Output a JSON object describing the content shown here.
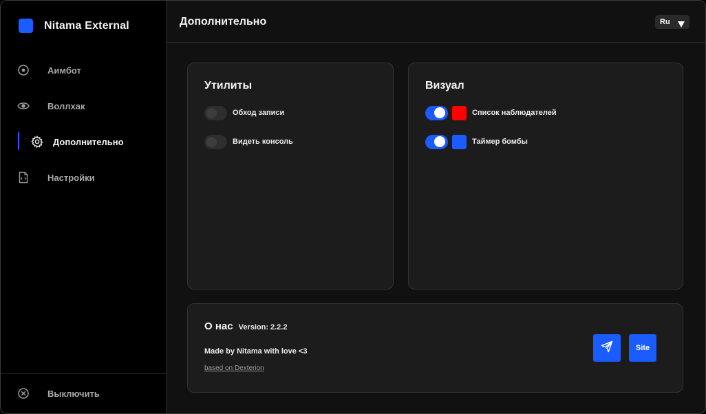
{
  "app": {
    "name": "Nitama External"
  },
  "sidebar": {
    "items": [
      {
        "label": "Аимбот",
        "icon": "target-icon"
      },
      {
        "label": "Воллхак",
        "icon": "eye-icon"
      },
      {
        "label": "Дополнительно",
        "icon": "gear-icon",
        "active": true
      },
      {
        "label": "Настройки",
        "icon": "code-file-icon"
      }
    ],
    "shutdown_label": "Выключить"
  },
  "header": {
    "title": "Дополнительно",
    "language": "Ru"
  },
  "utilities": {
    "title": "Утилиты",
    "toggles": [
      {
        "label": "Обход записи",
        "enabled": false
      },
      {
        "label": "Видеть консоль",
        "enabled": false
      }
    ]
  },
  "visual": {
    "title": "Визуал",
    "toggles": [
      {
        "label": "Список наблюдателей",
        "enabled": true,
        "color": "#ff0000"
      },
      {
        "label": "Таймер бомбы",
        "enabled": true,
        "color": "#1a5cff"
      }
    ]
  },
  "about": {
    "title": "О нас",
    "version_label": "Version:",
    "version": "2.2.2",
    "made_by": "Made by Nitama with love <3",
    "based_on": "based on Dexterion",
    "site_label": "Site",
    "telegram_icon": "paper-plane-icon"
  },
  "colors": {
    "accent": "#1a5cff",
    "background": "#111111",
    "sidebar": "#000000",
    "card": "#1c1c1c"
  }
}
